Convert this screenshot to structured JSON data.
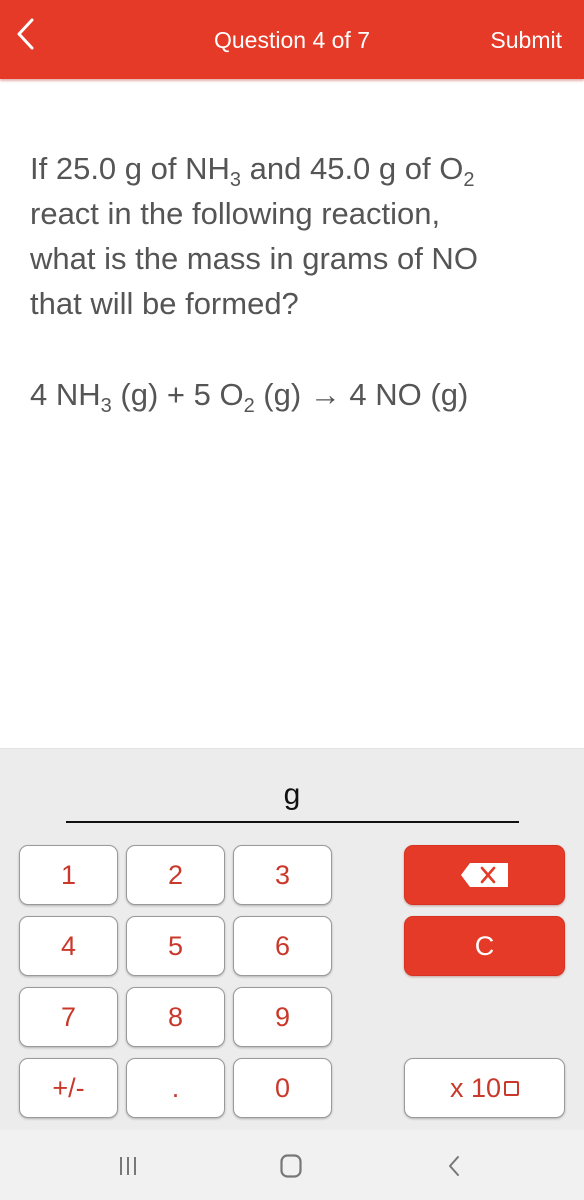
{
  "header": {
    "title": "Question 4 of 7",
    "submit_label": "Submit",
    "back_icon": "chevron-left-icon",
    "background_color": "#e53a27"
  },
  "question": {
    "segments": [
      {
        "text": "If 25.0 g of NH"
      },
      {
        "sub": "3"
      },
      {
        "text": " and 45.0 g of O"
      },
      {
        "sub": "2"
      },
      {
        "text": " react in the following reaction, what is the mass in grams of NO that will be formed?"
      }
    ],
    "equation": {
      "segments": [
        {
          "text": "4 NH"
        },
        {
          "sub": "3"
        },
        {
          "text": " (g) + 5 O"
        },
        {
          "sub": "2"
        },
        {
          "text": " (g) → 4 NO (g)"
        }
      ]
    }
  },
  "answer": {
    "value": "",
    "unit": "g"
  },
  "keypad": {
    "keys": [
      {
        "label": "1",
        "name": "key-1"
      },
      {
        "label": "2",
        "name": "key-2"
      },
      {
        "label": "3",
        "name": "key-3"
      },
      {
        "label": "4",
        "name": "key-4"
      },
      {
        "label": "5",
        "name": "key-5"
      },
      {
        "label": "6",
        "name": "key-6"
      },
      {
        "label": "7",
        "name": "key-7"
      },
      {
        "label": "8",
        "name": "key-8"
      },
      {
        "label": "9",
        "name": "key-9"
      },
      {
        "label": "+/-",
        "name": "key-plus-minus"
      },
      {
        "label": ".",
        "name": "key-decimal"
      },
      {
        "label": "0",
        "name": "key-0"
      }
    ],
    "backspace_icon": "backspace-icon",
    "clear_label": "C",
    "sci_label": "x 10",
    "sci_exponent_icon": "empty-box-icon",
    "key_text_color": "#c9382a",
    "action_color": "#e53a27"
  },
  "nav_bar": {
    "recent_apps_icon": "recent-apps-icon",
    "home_icon": "home-icon",
    "back_icon": "back-icon"
  }
}
